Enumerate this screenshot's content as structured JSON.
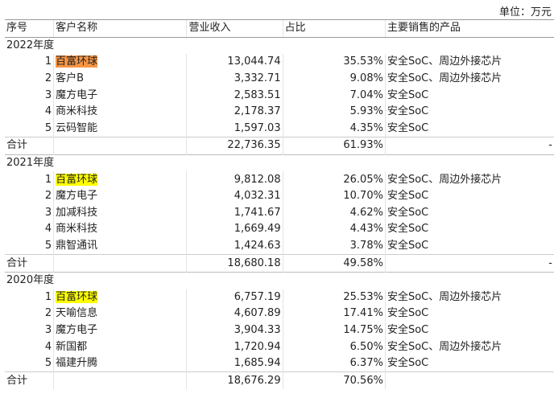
{
  "unit_label": "单位：万元",
  "headers": [
    "序号",
    "客户名称",
    "营业收入",
    "占比",
    "主要销售的产品"
  ],
  "sections": [
    {
      "year": "2022年度",
      "rows": [
        {
          "no": "1",
          "name": "百富环球",
          "revenue": "13,044.74",
          "share": "35.53%",
          "product": "安全SoC、周边外接芯片",
          "highlight": "#f79646"
        },
        {
          "no": "2",
          "name": "客户B",
          "revenue": "3,332.71",
          "share": "9.08%",
          "product": "安全SoC、周边外接芯片"
        },
        {
          "no": "3",
          "name": "魔方电子",
          "revenue": "2,583.51",
          "share": "7.04%",
          "product": "安全SoC"
        },
        {
          "no": "4",
          "name": "商米科技",
          "revenue": "2,178.37",
          "share": "5.93%",
          "product": "安全SoC"
        },
        {
          "no": "5",
          "name": "云码智能",
          "revenue": "1,597.03",
          "share": "4.35%",
          "product": "安全SoC"
        }
      ],
      "total": {
        "label": "合计",
        "revenue": "22,736.35",
        "share": "61.93%",
        "product": "-"
      }
    },
    {
      "year": "2021年度",
      "rows": [
        {
          "no": "1",
          "name": "百富环球",
          "revenue": "9,812.08",
          "share": "26.05%",
          "product": "安全SoC、周边外接芯片",
          "highlight": "#ffff00"
        },
        {
          "no": "2",
          "name": "魔方电子",
          "revenue": "4,032.31",
          "share": "10.70%",
          "product": "安全SoC"
        },
        {
          "no": "3",
          "name": "加减科技",
          "revenue": "1,741.67",
          "share": "4.62%",
          "product": "安全SoC"
        },
        {
          "no": "4",
          "name": "商米科技",
          "revenue": "1,669.49",
          "share": "4.43%",
          "product": "安全SoC"
        },
        {
          "no": "5",
          "name": "鼎智通讯",
          "revenue": "1,424.63",
          "share": "3.78%",
          "product": "安全SoC"
        }
      ],
      "total": {
        "label": "合计",
        "revenue": "18,680.18",
        "share": "49.58%",
        "product": "-"
      }
    },
    {
      "year": "2020年度",
      "rows": [
        {
          "no": "1",
          "name": "百富环球",
          "revenue": "6,757.19",
          "share": "25.53%",
          "product": "安全SoC、周边外接芯片",
          "highlight": "#ffff00"
        },
        {
          "no": "2",
          "name": "天喻信息",
          "revenue": "4,607.89",
          "share": "17.41%",
          "product": "安全SoC"
        },
        {
          "no": "3",
          "name": "魔方电子",
          "revenue": "3,904.33",
          "share": "14.75%",
          "product": "安全SoC"
        },
        {
          "no": "4",
          "name": "新国都",
          "revenue": "1,720.94",
          "share": "6.50%",
          "product": "安全SoC、周边外接芯片"
        },
        {
          "no": "5",
          "name": "福建升腾",
          "revenue": "1,685.94",
          "share": "6.37%",
          "product": "安全SoC"
        }
      ],
      "total": {
        "label": "合计",
        "revenue": "18,676.29",
        "share": "70.56%",
        "product": ""
      }
    }
  ]
}
